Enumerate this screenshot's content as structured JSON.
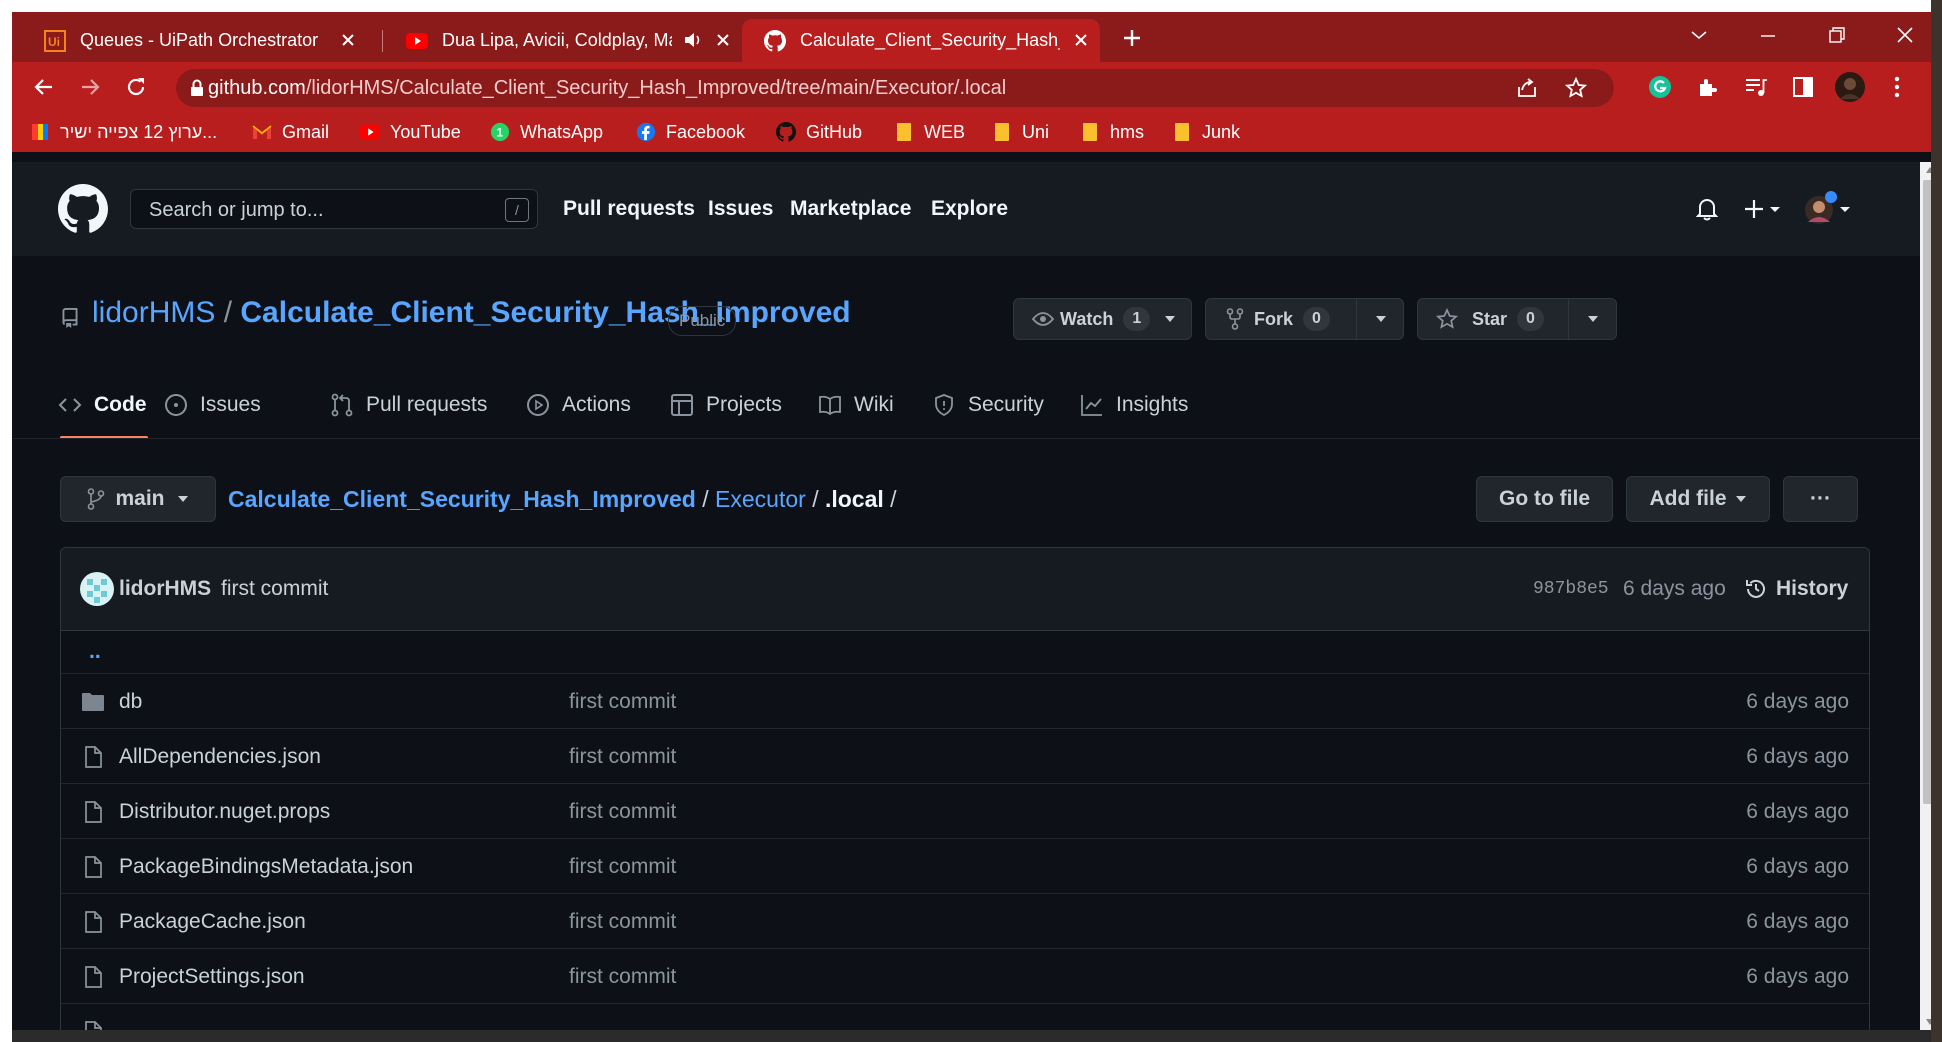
{
  "browser": {
    "tabs": [
      {
        "title": "Queues - UiPath Orchestrator",
        "icon": "uipath-icon",
        "active": false
      },
      {
        "title": "Dua Lipa, Avicii, Coldplay, Ma",
        "icon": "youtube-icon",
        "active": false,
        "audio": true
      },
      {
        "title": "Calculate_Client_Security_Hash_Ir",
        "icon": "github-icon",
        "active": true
      }
    ],
    "url_host": "github.com",
    "url_path": "/lidorHMS/Calculate_Client_Security_Hash_Improved/tree/main/Executor/.local",
    "bookmarks": [
      {
        "label": "ערוץ 12 צפייה ישיר...",
        "icon": "channel12-icon"
      },
      {
        "label": "Gmail",
        "icon": "gmail-icon"
      },
      {
        "label": "YouTube",
        "icon": "youtube-icon"
      },
      {
        "label": "WhatsApp",
        "icon": "whatsapp-icon"
      },
      {
        "label": "Facebook",
        "icon": "facebook-icon"
      },
      {
        "label": "GitHub",
        "icon": "github-icon"
      },
      {
        "label": "WEB",
        "icon": "folder-icon"
      },
      {
        "label": "Uni",
        "icon": "folder-icon"
      },
      {
        "label": "hms",
        "icon": "folder-icon"
      },
      {
        "label": "Junk",
        "icon": "folder-icon"
      }
    ]
  },
  "github": {
    "search_placeholder": "Search or jump to...",
    "search_key": "/",
    "nav": [
      "Pull requests",
      "Issues",
      "Marketplace",
      "Explore"
    ]
  },
  "repo": {
    "owner": "lidorHMS",
    "separator": "/",
    "name": "Calculate_Client_Security_Hash_Improved",
    "visibility": "Public",
    "watch_label": "Watch",
    "watch_count": "1",
    "fork_label": "Fork",
    "fork_count": "0",
    "star_label": "Star",
    "star_count": "0",
    "tabs": [
      "Code",
      "Issues",
      "Pull requests",
      "Actions",
      "Projects",
      "Wiki",
      "Security",
      "Insights"
    ],
    "active_tab": "Code"
  },
  "browser_path": {
    "branch": "main",
    "crumbs": [
      "Calculate_Client_Security_Hash_Improved",
      "Executor"
    ],
    "current": ".local",
    "go_to_file": "Go to file",
    "add_file": "Add file",
    "more": "···"
  },
  "commit": {
    "author": "lidorHMS",
    "message": "first commit",
    "sha": "987b8e5",
    "age": "6 days ago",
    "history_label": "History"
  },
  "files": [
    {
      "name": "..",
      "type": "parent",
      "message": "",
      "age": ""
    },
    {
      "name": "db",
      "type": "dir",
      "message": "first commit",
      "age": "6 days ago"
    },
    {
      "name": "AllDependencies.json",
      "type": "file",
      "message": "first commit",
      "age": "6 days ago"
    },
    {
      "name": "Distributor.nuget.props",
      "type": "file",
      "message": "first commit",
      "age": "6 days ago"
    },
    {
      "name": "PackageBindingsMetadata.json",
      "type": "file",
      "message": "first commit",
      "age": "6 days ago"
    },
    {
      "name": "PackageCache.json",
      "type": "file",
      "message": "first commit",
      "age": "6 days ago"
    },
    {
      "name": "ProjectSettings.json",
      "type": "file",
      "message": "first commit",
      "age": "6 days ago"
    }
  ],
  "colors": {
    "chrome_frame": "#b91e1e",
    "github_bg": "#0d1117",
    "link_blue": "#58a6ff",
    "active_tab_underline": "#f78166"
  }
}
